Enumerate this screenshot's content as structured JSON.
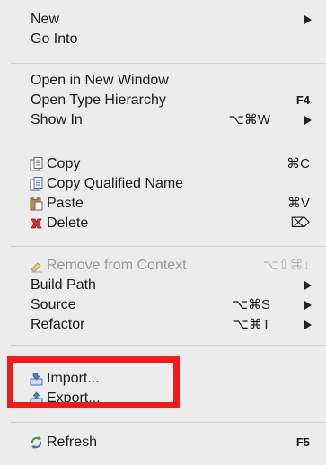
{
  "menu": {
    "groups": [
      [
        {
          "label": "New",
          "submenu": true
        },
        {
          "label": "Go Into"
        }
      ],
      [
        {
          "label": "Open in New Window"
        },
        {
          "label": "Open Type Hierarchy",
          "shortcut": "F4"
        },
        {
          "label": "Show In",
          "shortcut": "⌥⌘W",
          "submenu": true
        }
      ],
      [
        {
          "label": "Copy",
          "shortcut": "⌘C",
          "icon": "copy-icon"
        },
        {
          "label": "Copy Qualified Name",
          "icon": "copy-qualified-name-icon"
        },
        {
          "label": "Paste",
          "shortcut": "⌘V",
          "icon": "paste-icon"
        },
        {
          "label": "Delete",
          "shortcut": "⌦",
          "icon": "delete-icon"
        }
      ],
      [
        {
          "label": "Remove from Context",
          "shortcut": "⌥⇧⌘↓",
          "icon": "remove-context-icon",
          "disabled": true
        },
        {
          "label": "Build Path",
          "submenu": true
        },
        {
          "label": "Source",
          "shortcut": "⌥⌘S",
          "submenu": true
        },
        {
          "label": "Refactor",
          "shortcut": "⌥⌘T",
          "submenu": true
        }
      ],
      [
        {
          "label": "Import...",
          "icon": "import-icon"
        },
        {
          "label": "Export...",
          "icon": "export-icon"
        }
      ],
      [
        {
          "label": "Refresh",
          "shortcut": "F5",
          "icon": "refresh-icon"
        }
      ]
    ]
  },
  "highlight": {
    "color": "#ee1c1c",
    "target": "Import..."
  },
  "colors": {
    "background": "#ececec",
    "text": "#1a1a1a",
    "disabled": "#9a9a9a"
  }
}
